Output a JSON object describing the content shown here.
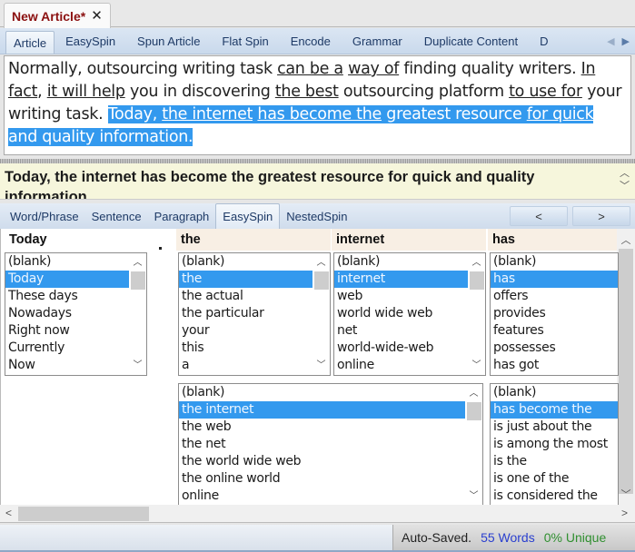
{
  "doc_tab": {
    "label": "New Article*",
    "close_icon": "close-icon"
  },
  "view_tabs": [
    {
      "label": "Article",
      "active": true
    },
    {
      "label": "EasySpin"
    },
    {
      "label": "Spun Article"
    },
    {
      "label": "Flat Spin"
    },
    {
      "label": "Encode"
    },
    {
      "label": "Grammar"
    },
    {
      "label": "Duplicate Content"
    },
    {
      "label": "D"
    }
  ],
  "view_tab_arrows": {
    "left": "◀",
    "right": "▶"
  },
  "article": {
    "segments": [
      {
        "text": "Normally, outsourcing writing task "
      },
      {
        "text": "can be a",
        "u": true
      },
      {
        "text": " "
      },
      {
        "text": "way of",
        "u": true
      },
      {
        "text": " finding quality writers. "
      },
      {
        "text": "In fact",
        "u": true
      },
      {
        "text": ", "
      },
      {
        "text": "it will help",
        "u": true
      },
      {
        "text": " you in discovering "
      },
      {
        "text": "the best",
        "u": true
      },
      {
        "text": " outsourcing platform "
      },
      {
        "text": "to use for",
        "u": true
      },
      {
        "text": " your writing task. "
      },
      {
        "text": "Today, ",
        "sel": true
      },
      {
        "text": "the internet",
        "u": true,
        "sel": true
      },
      {
        "text": " ",
        "sel": true
      },
      {
        "text": "has become the",
        "u": true,
        "sel": true
      },
      {
        "text": " greatest resource ",
        "sel": true
      },
      {
        "text": "for quick",
        "u": true,
        "sel": true
      },
      {
        "text": " and quality information.",
        "sel": true
      }
    ]
  },
  "sentence": {
    "text": "Today, the internet has become the greatest resource for quick and quality information"
  },
  "spin_tabs": [
    {
      "label": "Word/Phrase"
    },
    {
      "label": "Sentence"
    },
    {
      "label": "Paragraph"
    },
    {
      "label": "EasySpin",
      "active": true
    },
    {
      "label": "NestedSpin"
    }
  ],
  "nav": {
    "prev": "<",
    "next": ">"
  },
  "columns": [
    {
      "header": "Today",
      "items": [
        "(blank)",
        "Today",
        "These days",
        "Nowadays",
        "Right now",
        "Currently",
        "Now"
      ],
      "selected": 1
    },
    {
      "header": "the",
      "items": [
        "(blank)",
        "the",
        "the actual",
        "the particular",
        "your",
        "this",
        "a"
      ],
      "selected": 1
    },
    {
      "header": "internet",
      "items": [
        "(blank)",
        "internet",
        "web",
        "world wide web",
        "net",
        "world-wide-web",
        "online"
      ],
      "selected": 1
    },
    {
      "header": "has",
      "items": [
        "(blank)",
        "has",
        "offers",
        "provides",
        "features",
        "possesses",
        "has got"
      ],
      "selected": 1
    }
  ],
  "phrase_lists": [
    {
      "items": [
        "(blank)",
        "the internet",
        "the web",
        "the net",
        "the world wide web",
        "the online world",
        "online"
      ],
      "selected": 1
    },
    {
      "items": [
        "(blank)",
        "has become the",
        "is just about the",
        "is among the most",
        "is the",
        "is one of the",
        "is considered the"
      ],
      "selected": 1
    }
  ],
  "status": {
    "saved": "Auto-Saved.",
    "words": "55 Words",
    "unique": "0% Unique"
  }
}
